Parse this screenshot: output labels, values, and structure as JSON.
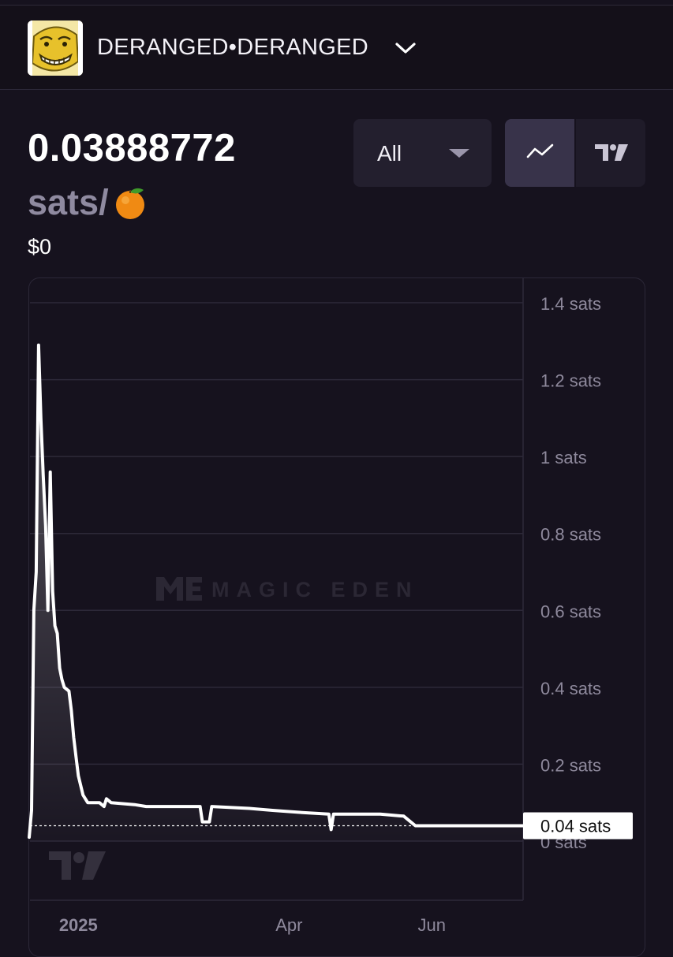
{
  "header": {
    "collection_name": "DERANGED•DERANGED",
    "avatar_icon": "deranged-face-avatar",
    "dropdown_icon": "chevron-down-icon"
  },
  "price": {
    "value": "0.03888772",
    "unit": "sats/",
    "unit_icon": "orange-emoji-icon",
    "usd": "$0"
  },
  "controls": {
    "range_label": "All",
    "range_icon": "caret-down-icon",
    "chart_modes": [
      "line-chart-icon",
      "tradingview-icon"
    ],
    "active_mode": "line-chart-icon"
  },
  "watermark": {
    "brand": "MAGIC EDEN",
    "logo_icon": "magic-eden-logo-icon",
    "chart_logo_icon": "tradingview-logo-icon"
  },
  "colors": {
    "background": "#16121e",
    "line": "#ffffff",
    "muted_text": "#8f8aa0",
    "panel": "#231f2e"
  },
  "chart_data": {
    "type": "line",
    "y_unit": "sats",
    "ylim": [
      0,
      1.4
    ],
    "y_ticks": [
      {
        "value": 1.4,
        "label": "1.4 sats"
      },
      {
        "value": 1.2,
        "label": "1.2 sats"
      },
      {
        "value": 1.0,
        "label": "1 sats"
      },
      {
        "value": 0.8,
        "label": "0.8 sats"
      },
      {
        "value": 0.6,
        "label": "0.6 sats"
      },
      {
        "value": 0.4,
        "label": "0.4 sats"
      },
      {
        "value": 0.2,
        "label": "0.2 sats"
      },
      {
        "value": 0,
        "label": "0 sats"
      }
    ],
    "x_range": [
      "2024-12-11",
      "2025-07-10"
    ],
    "x_ticks": [
      {
        "date": "2025-01-01",
        "label": "2025",
        "bold": true
      },
      {
        "date": "2025-04-01",
        "label": "Apr",
        "bold": false
      },
      {
        "date": "2025-06-01",
        "label": "Jun",
        "bold": false
      }
    ],
    "current_price": {
      "value": 0.04,
      "label": "0.04 sats"
    },
    "grid": true,
    "series": [
      {
        "points": [
          [
            "2024-12-11",
            0.01
          ],
          [
            "2024-12-12",
            0.08
          ],
          [
            "2024-12-13",
            0.6
          ],
          [
            "2024-12-14",
            0.7
          ],
          [
            "2024-12-15",
            1.29
          ],
          [
            "2024-12-16",
            1.1
          ],
          [
            "2024-12-17",
            0.95
          ],
          [
            "2024-12-18",
            0.82
          ],
          [
            "2024-12-19",
            0.6
          ],
          [
            "2024-12-20",
            0.96
          ],
          [
            "2024-12-21",
            0.65
          ],
          [
            "2024-12-22",
            0.56
          ],
          [
            "2024-12-23",
            0.54
          ],
          [
            "2024-12-24",
            0.45
          ],
          [
            "2024-12-25",
            0.42
          ],
          [
            "2024-12-26",
            0.4
          ],
          [
            "2024-12-28",
            0.39
          ],
          [
            "2024-12-29",
            0.34
          ],
          [
            "2024-12-30",
            0.27
          ],
          [
            "2024-12-31",
            0.22
          ],
          [
            "2025-01-01",
            0.17
          ],
          [
            "2025-01-03",
            0.12
          ],
          [
            "2025-01-05",
            0.1
          ],
          [
            "2025-01-10",
            0.1
          ],
          [
            "2025-01-12",
            0.09
          ],
          [
            "2025-01-13",
            0.11
          ],
          [
            "2025-01-15",
            0.1
          ],
          [
            "2025-01-25",
            0.095
          ],
          [
            "2025-01-30",
            0.09
          ],
          [
            "2025-02-15",
            0.09
          ],
          [
            "2025-02-22",
            0.09
          ],
          [
            "2025-02-23",
            0.05
          ],
          [
            "2025-02-26",
            0.05
          ],
          [
            "2025-02-27",
            0.09
          ],
          [
            "2025-03-15",
            0.085
          ],
          [
            "2025-03-25",
            0.08
          ],
          [
            "2025-04-05",
            0.075
          ],
          [
            "2025-04-18",
            0.07
          ],
          [
            "2025-04-19",
            0.03
          ],
          [
            "2025-04-20",
            0.07
          ],
          [
            "2025-05-10",
            0.07
          ],
          [
            "2025-05-20",
            0.065
          ],
          [
            "2025-05-25",
            0.04
          ],
          [
            "2025-07-10",
            0.04
          ]
        ]
      }
    ]
  }
}
